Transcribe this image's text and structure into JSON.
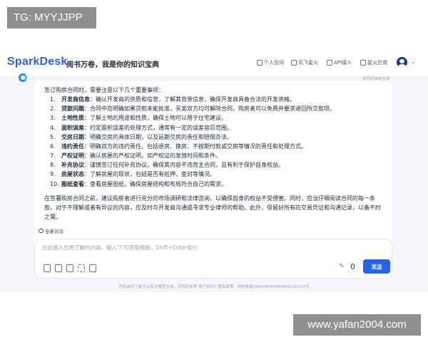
{
  "watermarks": {
    "top_left": "TG: MYYJJPP",
    "bottom_right": "www.yafan2004.com"
  },
  "header": {
    "logo": "SparkDesk",
    "slogan": "阅书万卷，我是你的知识宝典",
    "nav": [
      {
        "label": "个人空间",
        "icon": "person-space-icon"
      },
      {
        "label": "讯飞星火",
        "icon": "spark-icon"
      },
      {
        "label": "API接入",
        "icon": "api-icon"
      },
      {
        "label": "星火应用",
        "icon": "apps-icon"
      }
    ],
    "avatar_icon": "user-avatar-icon"
  },
  "chat": {
    "ai_note": "该内容由AI生成",
    "intro": "签订购房合同时，需要注意以下几个重要事项：",
    "items": [
      {
        "num": "1.",
        "title": "开发商信息",
        "text": "：确认开发商的资质和信誉，了解其背景信息，确保开发商具备合法的开发资格。"
      },
      {
        "num": "2.",
        "title": "贷款问题",
        "text": "：合同中应明确如果贷款未能批准，买卖双方均可解除合同，购房者可以免费并要求退回所交款项。"
      },
      {
        "num": "3.",
        "title": "土地性质",
        "text": "：了解土地的用途和性质，确保土地可以用于住宅建设。"
      },
      {
        "num": "4.",
        "title": "面积误差",
        "text": "：约定面积误差的处理方式，通常有一定的误差容忍范围。"
      },
      {
        "num": "5.",
        "title": "交房日期",
        "text": "：明确交房的具体日期，以及延期交房的责任和赔偿办法。"
      },
      {
        "num": "6.",
        "title": "违约责任",
        "text": "：明确双方的违约责任，包括退房、换房、不按期付款或交房等情况的责任和处理方式。"
      },
      {
        "num": "7.",
        "title": "产权证明",
        "text": "：确认房屋的产权证明，如产权证的发放时间和条件。"
      },
      {
        "num": "8.",
        "title": "补充协议",
        "text": "：谨慎签订任何补充协议，确保其内容不违背主合同，且有利于保护自身权益。"
      },
      {
        "num": "9.",
        "title": "房屋状态",
        "text": "：了解房屋的现状，包括是否有抵押、查封等情况。"
      },
      {
        "num": "10.",
        "title": "图纸查看",
        "text": "：查看房屋图纸，确保房屋结构和布局符合自己的需求。"
      }
    ],
    "closing": "在签署购房合同之前，建议购房者进行充分的市场调研和法律咨询，以确保自身的权益不受侵害。同时，应当仔细阅读合同的每一条款，对于不理解或者有异议的内容，应及时与开发商沟通或寻求专业律师的帮助。此外，保留好所有的交易凭证和沟通记录，以备不时之需。"
  },
  "new_chat_label": "全新对话",
  "input": {
    "placeholder": "在此输入您想了解的内容，输入\"/\"可获取模版，Shift+Enter换行",
    "send_label": "发送",
    "tools": [
      "doc-icon",
      "pdf-icon",
      "image-icon",
      "scan-icon",
      "file-icon"
    ]
  },
  "footer": "内容由讯飞星火认知大模型生成，仅供您参考 用户协议 | 隐私政策 · 网信算备340104764864601230021号"
}
